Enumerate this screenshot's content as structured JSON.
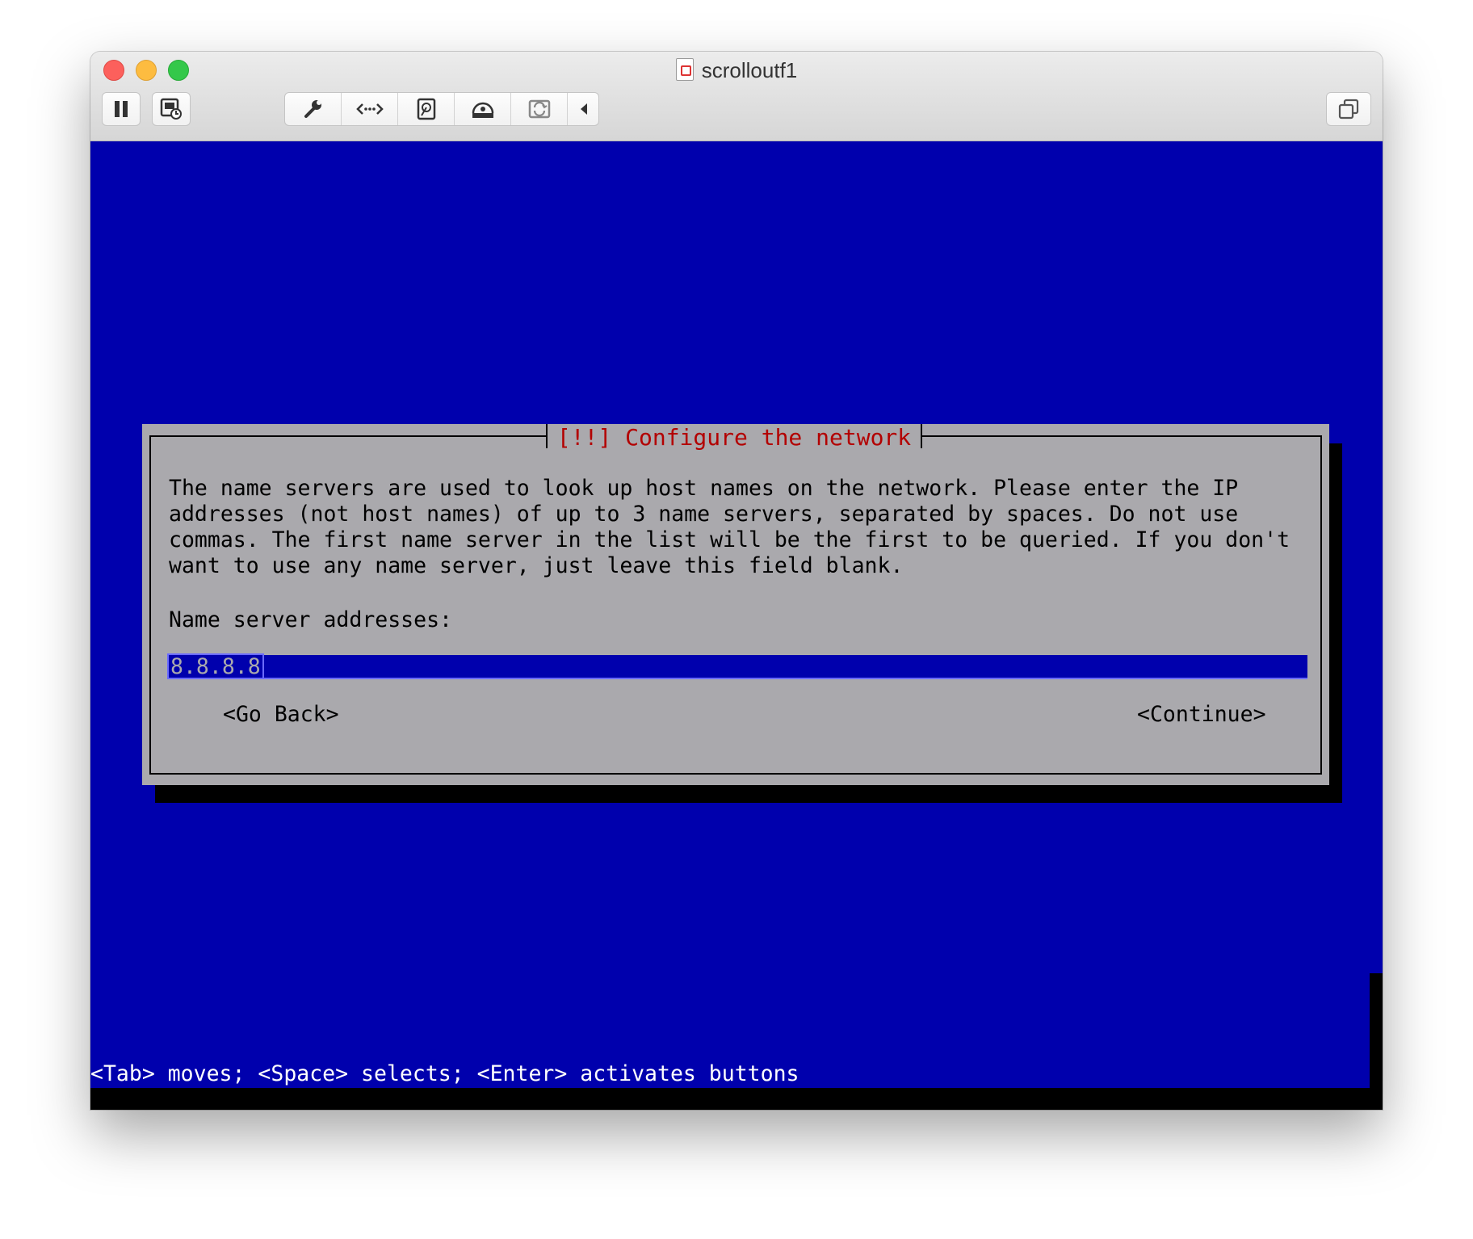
{
  "window": {
    "title": "scrolloutf1"
  },
  "toolbar": {
    "pause_icon": "pause-icon",
    "snapshot_icon": "snapshot-icon",
    "settings_icon": "wrench-icon",
    "network_icon": "network-arrows-icon",
    "harddisk_icon": "hard-disk-icon",
    "optical_icon": "optical-disc-icon",
    "sharing_icon": "shared-folder-icon",
    "collapse_icon": "chevron-left-icon",
    "fullscreen_icon": "restore-window-icon"
  },
  "dialog": {
    "title": "[!!] Configure the network",
    "text": "The name servers are used to look up host names on the network. Please enter the IP\naddresses (not host names) of up to 3 name servers, separated by spaces. Do not use\ncommas. The first name server in the list will be the first to be queried. If you don't\nwant to use any name server, just leave this field blank.",
    "field_label": "Name server addresses:",
    "field_value": "8.8.8.8",
    "go_back": "<Go Back>",
    "continue": "<Continue>"
  },
  "statusbar": {
    "text": "<Tab> moves; <Space> selects; <Enter> activates buttons"
  },
  "colors": {
    "screen_bg": "#0000ad",
    "dialog_bg": "#aaa9ad",
    "title_red": "#b30000"
  }
}
